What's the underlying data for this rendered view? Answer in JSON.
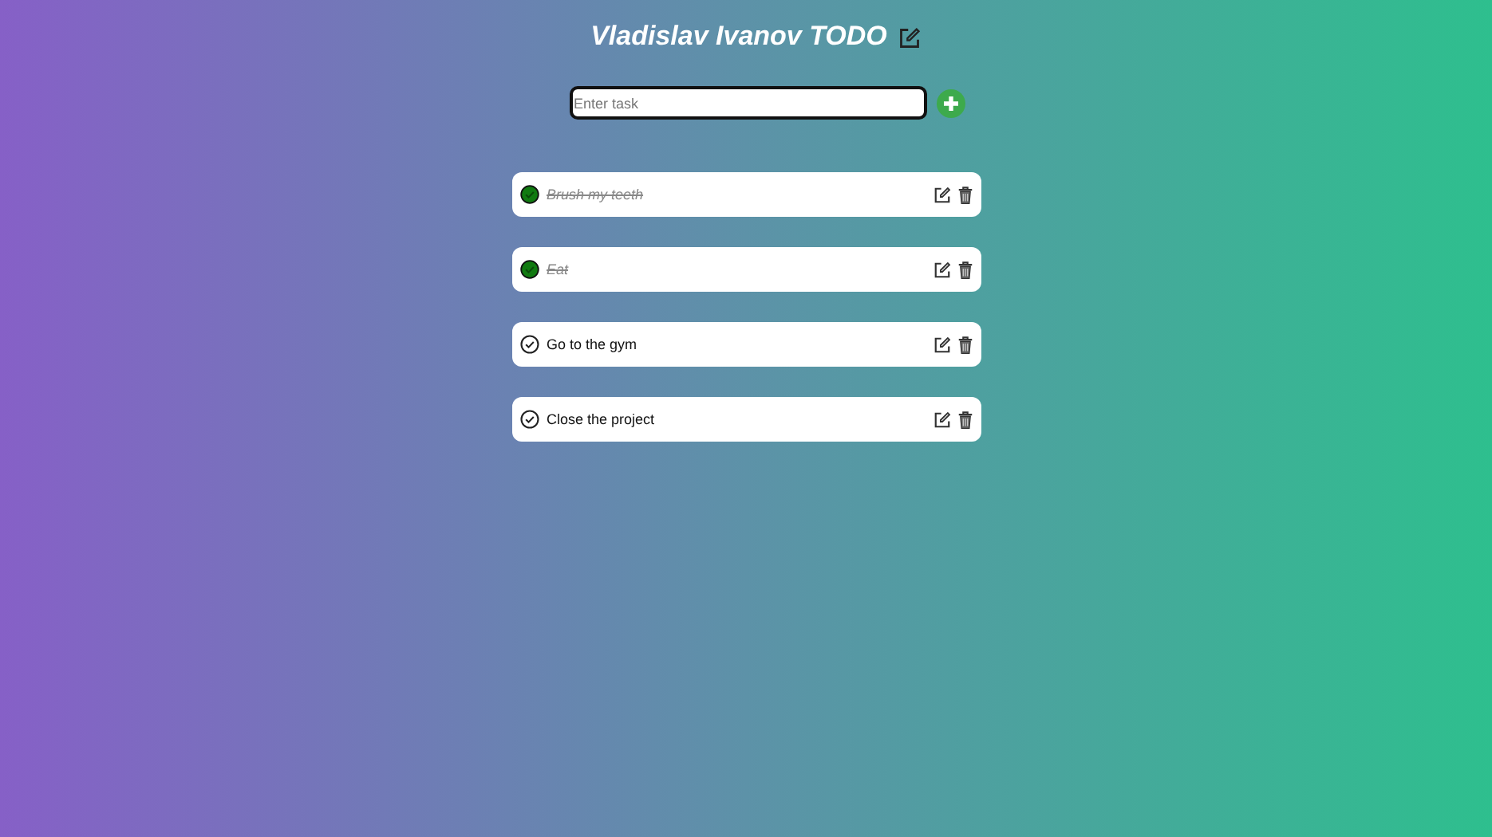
{
  "header": {
    "title": "Vladislav Ivanov TODO"
  },
  "new_task": {
    "placeholder": "Enter task"
  },
  "tasks": [
    {
      "text": "Brush my teeth",
      "done": true
    },
    {
      "text": "Eat",
      "done": true
    },
    {
      "text": "Go to the gym",
      "done": false
    },
    {
      "text": "Close the project",
      "done": false
    }
  ]
}
